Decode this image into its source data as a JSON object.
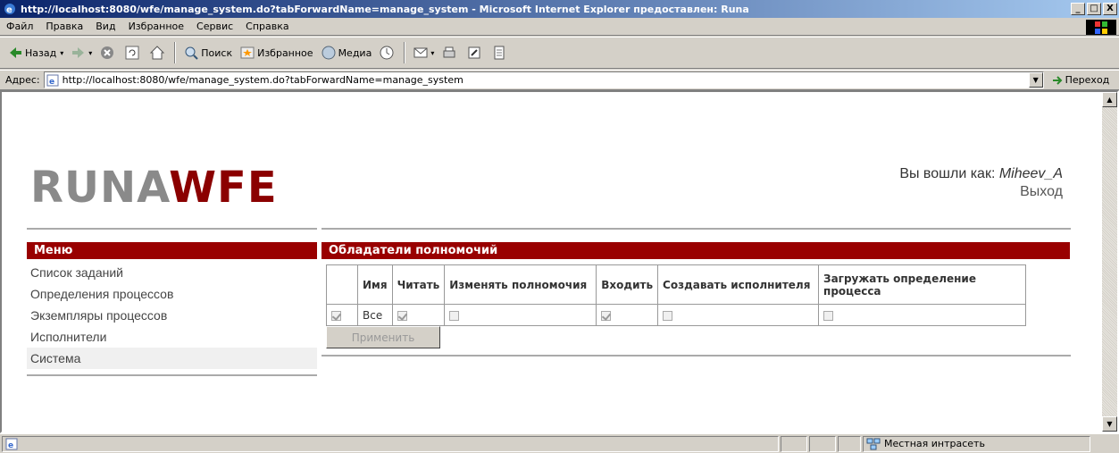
{
  "window": {
    "title": "http://localhost:8080/wfe/manage_system.do?tabForwardName=manage_system - Microsoft Internet Explorer предоставлен: Runa",
    "minimize": "_",
    "maximize": "□",
    "close": "X"
  },
  "menubar": {
    "items": [
      "Файл",
      "Правка",
      "Вид",
      "Избранное",
      "Сервис",
      "Справка"
    ]
  },
  "toolbar": {
    "back_label": "Назад",
    "search_label": "Поиск",
    "favorites_label": "Избранное",
    "media_label": "Медиа"
  },
  "address": {
    "label": "Адрес:",
    "url": "http://localhost:8080/wfe/manage_system.do?tabForwardName=manage_system",
    "go_label": "Переход"
  },
  "page": {
    "logo_left": "RUNA",
    "logo_right": "WFE",
    "login_prefix": "Вы вошли как: ",
    "login_user": "Miheev_A",
    "logout": "Выход"
  },
  "menu": {
    "title": "Меню",
    "items": [
      "Список заданий",
      "Определения процессов",
      "Экземпляры процессов",
      "Исполнители",
      "Система"
    ],
    "active_index": 4
  },
  "permissions": {
    "title": "Обладатели полномочий",
    "columns": [
      "",
      "Имя",
      "Читать",
      "Изменять полномочия",
      "Входить",
      "Создавать исполнителя",
      "Загружать определение процесса"
    ],
    "rows": [
      {
        "name": "Все",
        "select": true,
        "read": true,
        "change": false,
        "login": true,
        "create": false,
        "load": false
      }
    ],
    "apply_label": "Применить"
  },
  "statusbar": {
    "zone": "Местная интрасеть"
  },
  "colors": {
    "brand_red": "#990000",
    "logo_grey": "#8a8a8a"
  }
}
